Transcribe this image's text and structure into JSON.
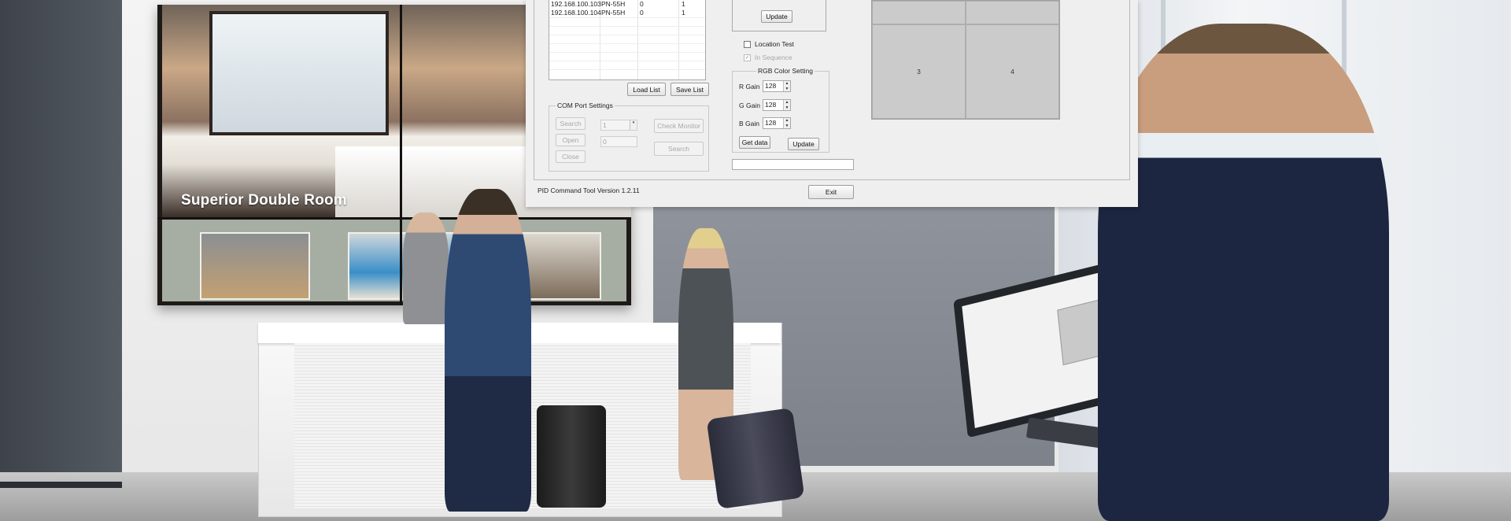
{
  "scene": {
    "video_wall_title": "Superior Double Room"
  },
  "dialog": {
    "device_list": {
      "rows": [
        {
          "ip": "192.168.100.103",
          "model": "PN-55H",
          "col3": "0",
          "col4": "1"
        },
        {
          "ip": "192.168.100.104",
          "model": "PN-55H",
          "col3": "0",
          "col4": "1"
        }
      ],
      "load_label": "Load List",
      "save_label": "Save List"
    },
    "top_update_label": "Update",
    "com_port": {
      "legend": "COM Port Settings",
      "search_label": "Search",
      "open_label": "Open",
      "close_label": "Close",
      "port_value": "1",
      "id_value": "0",
      "check_monitor_label": "Check Monitor",
      "search2_label": "Search"
    },
    "location_test_label": "Location Test",
    "in_sequence_label": "In Sequence",
    "rgb": {
      "legend": "RGB Color Setting",
      "r_label": "R Gain",
      "g_label": "G Gain",
      "b_label": "B Gain",
      "r_value": "128",
      "g_value": "128",
      "b_value": "128",
      "get_data_label": "Get data",
      "update_label": "Update"
    },
    "layout_cells": [
      "",
      "",
      "3",
      "4"
    ],
    "version_text": "PID Command Tool Version 1.2.11",
    "exit_label": "Exit"
  }
}
